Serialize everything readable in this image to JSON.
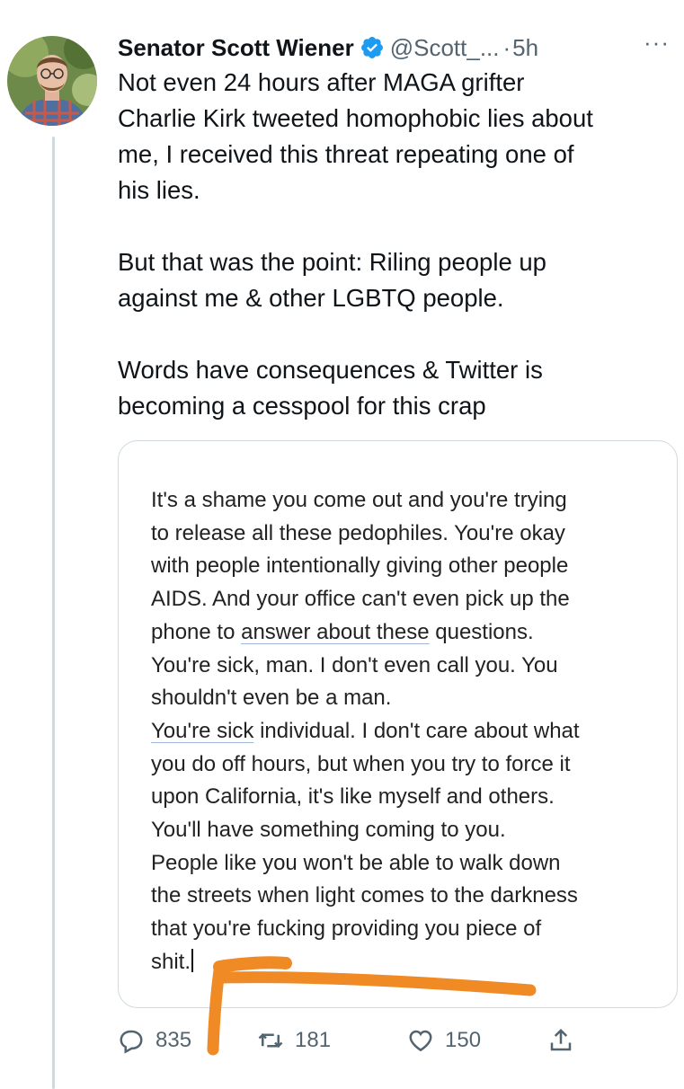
{
  "author": {
    "name": "Senator Scott Wiener",
    "handle": "@Scott_...",
    "separator": "·",
    "time": "5h",
    "avatar_icon": "avatar-photo",
    "verified_icon": "verified-badge-icon",
    "verified_color": "#1d9bf0"
  },
  "more_icon": "···",
  "tweet": {
    "lines": [
      "Not even 24 hours after MAGA grifter",
      "Charlie Kirk tweeted homophobic lies about",
      "me, I received this threat repeating one of",
      "his lies."
    ],
    "para2": [
      "But that was the point: Riling people up",
      "against me & other LGBTQ people."
    ],
    "para3": [
      "Words have consequences & Twitter is",
      "becoming a cesspool for this crap"
    ]
  },
  "media": {
    "lines": [
      "It's a shame you come out and you're trying",
      "to release all these pedophiles. You're okay",
      "with people intentionally giving other people",
      "AIDS. And your office can't even pick up the",
      "phone to ",
      "answer about these",
      " questions.",
      "You're sick, man. I don't even call you. You",
      "shouldn't even be a man.",
      "You're sick",
      " individual. I don't care about what",
      "you do off hours, but when you try to force it",
      "upon California, it's like myself and others.",
      "You'll have something coming to you.",
      "People like you won't be able to walk down",
      "the streets when light comes to the darkness",
      "that you're fucking providing you piece of",
      "shit."
    ]
  },
  "actions": {
    "reply": {
      "icon": "reply-icon",
      "count": "835"
    },
    "retweet": {
      "icon": "retweet-icon",
      "count": "181"
    },
    "like": {
      "icon": "heart-icon",
      "count": "150"
    },
    "share": {
      "icon": "share-icon"
    }
  },
  "colors": {
    "text": "#0f1419",
    "secondary": "#536471",
    "annotation": "#f08a24"
  }
}
